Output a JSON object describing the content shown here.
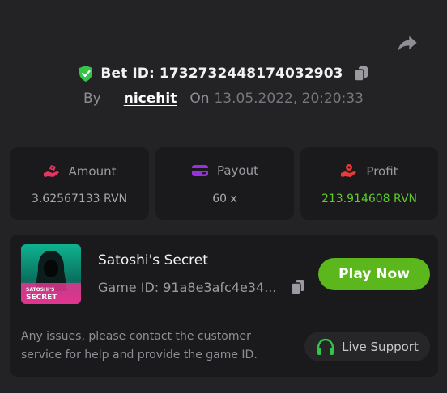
{
  "header": {
    "bet_id_label": "Bet ID: 1732732448174032903",
    "by_label": "By",
    "username": "nicehit",
    "on_label": "On",
    "timestamp": "13.05.2022, 20:20:33"
  },
  "stats": [
    {
      "label": "Amount",
      "value": "3.62567133 RVN",
      "icon": "money-hand-icon"
    },
    {
      "label": "Payout",
      "value": "60 x",
      "icon": "wallet-icon"
    },
    {
      "label": "Profit",
      "value": "213.914608 RVN",
      "icon": "profit-hand-icon"
    }
  ],
  "game": {
    "title": "Satoshi's Secret",
    "game_id": "Game ID: 91a8e3afc4e34...",
    "play_label": "Play Now",
    "thumb_text_line1": "SATOSHI'S",
    "thumb_text_line2": "SECRET"
  },
  "support": {
    "text": "Any issues, please contact the customer service for help and provide the game ID.",
    "button_label": "Live Support"
  },
  "colors": {
    "background": "#232325",
    "card": "#1a1a1c",
    "accent_green": "#5bb71c",
    "profit_green": "#5ccc27",
    "amount_icon": "#e8325f",
    "payout_icon": "#9a2fe0",
    "profit_icon": "#e83a3a"
  }
}
